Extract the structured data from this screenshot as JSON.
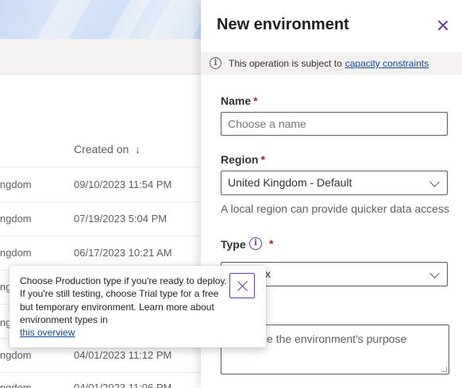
{
  "background": {
    "column_header": "Created on",
    "sort_arrow": "↓",
    "rows": [
      {
        "region": "ingdom",
        "created": "09/10/2023 11:54 PM"
      },
      {
        "region": "ingdom",
        "created": "07/19/2023 5:04 PM"
      },
      {
        "region": "ingdom",
        "created": "06/17/2023 10:21 AM"
      },
      {
        "region": "ing",
        "created": ""
      },
      {
        "region": "ingdom",
        "created": "04/01/2023 11:12 PM"
      },
      {
        "region": "ingdom",
        "created": "04/01/2023 11:06 PM"
      }
    ]
  },
  "panel": {
    "title": "New environment",
    "message": {
      "text": "This operation is subject to",
      "link": "capacity constraints"
    },
    "name_field": {
      "label": "Name",
      "required_mark": "*",
      "placeholder": "Choose a name"
    },
    "region_field": {
      "label": "Region",
      "required_mark": "*",
      "value": "United Kingdom - Default",
      "helper": "A local region can provide quicker data access"
    },
    "type_field": {
      "label": "Type",
      "required_mark": "*",
      "value_visible": "x"
    },
    "description_field": {
      "placeholder_visible": "e the environment's purpose"
    }
  },
  "callout": {
    "lines": [
      "Choose Production type if you're ready to deploy.",
      "If you're still testing, choose Trial type for a free",
      "but temporary environment. Learn more about",
      "environment types in"
    ],
    "link": "this overview"
  },
  "icons": {
    "info": "info-icon",
    "close": "close-icon",
    "chevron": "chevron-down-icon"
  },
  "colors": {
    "accent": "#6b3aa3",
    "link": "#0f4a9c",
    "required": "#a4262c"
  }
}
